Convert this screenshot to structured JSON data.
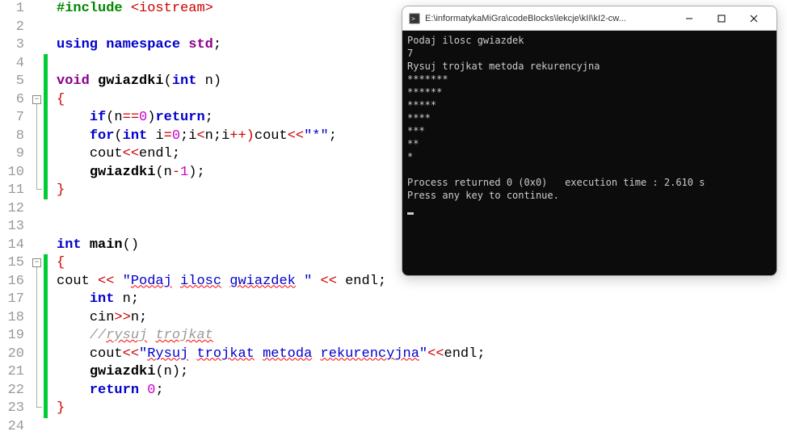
{
  "editor": {
    "lines": [
      {
        "n": "1",
        "tokens": [
          {
            "t": "#include ",
            "c": "kw-pre"
          },
          {
            "t": "<iostream>",
            "c": "angle"
          }
        ]
      },
      {
        "n": "2",
        "tokens": []
      },
      {
        "n": "3",
        "tokens": [
          {
            "t": "using ",
            "c": "kw"
          },
          {
            "t": "namespace ",
            "c": "kw"
          },
          {
            "t": "std",
            "c": "type"
          },
          {
            "t": ";",
            "c": "id"
          }
        ]
      },
      {
        "n": "4",
        "tokens": []
      },
      {
        "n": "5",
        "tokens": [
          {
            "t": "void ",
            "c": "type"
          },
          {
            "t": "gwiazdki",
            "c": "func"
          },
          {
            "t": "(",
            "c": "id"
          },
          {
            "t": "int ",
            "c": "kw"
          },
          {
            "t": "n",
            "c": "id"
          },
          {
            "t": ")",
            "c": "id"
          }
        ]
      },
      {
        "n": "6",
        "tokens": [
          {
            "t": "{",
            "c": "op"
          }
        ]
      },
      {
        "n": "7",
        "tokens": [
          {
            "t": "    ",
            "c": ""
          },
          {
            "t": "if",
            "c": "kw"
          },
          {
            "t": "(",
            "c": "id"
          },
          {
            "t": "n",
            "c": "id"
          },
          {
            "t": "==",
            "c": "op"
          },
          {
            "t": "0",
            "c": "num"
          },
          {
            "t": ")",
            "c": "id"
          },
          {
            "t": "return",
            "c": "kw"
          },
          {
            "t": ";",
            "c": "id"
          }
        ]
      },
      {
        "n": "8",
        "tokens": [
          {
            "t": "    ",
            "c": ""
          },
          {
            "t": "for",
            "c": "kw"
          },
          {
            "t": "(",
            "c": "id"
          },
          {
            "t": "int ",
            "c": "kw"
          },
          {
            "t": "i",
            "c": "id"
          },
          {
            "t": "=",
            "c": "op"
          },
          {
            "t": "0",
            "c": "num"
          },
          {
            "t": ";",
            "c": "id"
          },
          {
            "t": "i",
            "c": "id"
          },
          {
            "t": "<",
            "c": "op"
          },
          {
            "t": "n",
            "c": "id"
          },
          {
            "t": ";",
            "c": "id"
          },
          {
            "t": "i",
            "c": "id"
          },
          {
            "t": "++)",
            "c": "op"
          },
          {
            "t": "cout",
            "c": "id"
          },
          {
            "t": "<<",
            "c": "op"
          },
          {
            "t": "\"*\"",
            "c": "str"
          },
          {
            "t": ";",
            "c": "id"
          }
        ]
      },
      {
        "n": "9",
        "tokens": [
          {
            "t": "    ",
            "c": ""
          },
          {
            "t": "cout",
            "c": "id"
          },
          {
            "t": "<<",
            "c": "op"
          },
          {
            "t": "endl",
            "c": "id"
          },
          {
            "t": ";",
            "c": "id"
          }
        ]
      },
      {
        "n": "10",
        "tokens": [
          {
            "t": "    ",
            "c": ""
          },
          {
            "t": "gwiazdki",
            "c": "func"
          },
          {
            "t": "(",
            "c": "id"
          },
          {
            "t": "n",
            "c": "id"
          },
          {
            "t": "-",
            "c": "op"
          },
          {
            "t": "1",
            "c": "num"
          },
          {
            "t": ")",
            "c": "id"
          },
          {
            "t": ";",
            "c": "id"
          }
        ]
      },
      {
        "n": "11",
        "tokens": [
          {
            "t": "}",
            "c": "op"
          }
        ]
      },
      {
        "n": "12",
        "tokens": []
      },
      {
        "n": "13",
        "tokens": []
      },
      {
        "n": "14",
        "tokens": [
          {
            "t": "int ",
            "c": "kw"
          },
          {
            "t": "main",
            "c": "func"
          },
          {
            "t": "()",
            "c": "id"
          }
        ]
      },
      {
        "n": "15",
        "tokens": [
          {
            "t": "{",
            "c": "op"
          }
        ]
      },
      {
        "n": "16",
        "tokens": [
          {
            "t": "cout",
            "c": "id"
          },
          {
            "t": " << ",
            "c": "op"
          },
          {
            "t": "\"",
            "c": "str"
          },
          {
            "t": "Podaj",
            "c": "str squiggle"
          },
          {
            "t": " ",
            "c": "str"
          },
          {
            "t": "ilosc",
            "c": "str squiggle"
          },
          {
            "t": " ",
            "c": "str"
          },
          {
            "t": "gwiazdek",
            "c": "str squiggle"
          },
          {
            "t": " \"",
            "c": "str"
          },
          {
            "t": " << ",
            "c": "op"
          },
          {
            "t": "endl",
            "c": "id"
          },
          {
            "t": ";",
            "c": "id"
          }
        ]
      },
      {
        "n": "17",
        "tokens": [
          {
            "t": "    ",
            "c": ""
          },
          {
            "t": "int ",
            "c": "kw"
          },
          {
            "t": "n",
            "c": "id"
          },
          {
            "t": ";",
            "c": "id"
          }
        ]
      },
      {
        "n": "18",
        "tokens": [
          {
            "t": "    ",
            "c": ""
          },
          {
            "t": "cin",
            "c": "id"
          },
          {
            "t": ">>",
            "c": "op"
          },
          {
            "t": "n",
            "c": "id"
          },
          {
            "t": ";",
            "c": "id"
          }
        ]
      },
      {
        "n": "19",
        "tokens": [
          {
            "t": "    ",
            "c": ""
          },
          {
            "t": "//",
            "c": "comment"
          },
          {
            "t": "rysuj",
            "c": "comment squiggle"
          },
          {
            "t": " ",
            "c": "comment"
          },
          {
            "t": "trojkat",
            "c": "comment squiggle"
          }
        ]
      },
      {
        "n": "20",
        "tokens": [
          {
            "t": "    ",
            "c": ""
          },
          {
            "t": "cout",
            "c": "id"
          },
          {
            "t": "<<",
            "c": "op"
          },
          {
            "t": "\"",
            "c": "str"
          },
          {
            "t": "Rysuj",
            "c": "str squiggle"
          },
          {
            "t": " ",
            "c": "str"
          },
          {
            "t": "trojkat",
            "c": "str squiggle"
          },
          {
            "t": " ",
            "c": "str"
          },
          {
            "t": "metoda",
            "c": "str squiggle"
          },
          {
            "t": " ",
            "c": "str"
          },
          {
            "t": "rekurencyjna",
            "c": "str squiggle"
          },
          {
            "t": "\"",
            "c": "str"
          },
          {
            "t": "<<",
            "c": "op"
          },
          {
            "t": "endl",
            "c": "id"
          },
          {
            "t": ";",
            "c": "id"
          }
        ]
      },
      {
        "n": "21",
        "tokens": [
          {
            "t": "    ",
            "c": ""
          },
          {
            "t": "gwiazdki",
            "c": "func"
          },
          {
            "t": "(",
            "c": "id"
          },
          {
            "t": "n",
            "c": "id"
          },
          {
            "t": ")",
            "c": "id"
          },
          {
            "t": ";",
            "c": "id"
          }
        ]
      },
      {
        "n": "22",
        "tokens": [
          {
            "t": "    ",
            "c": ""
          },
          {
            "t": "return ",
            "c": "kw"
          },
          {
            "t": "0",
            "c": "num"
          },
          {
            "t": ";",
            "c": "id"
          }
        ]
      },
      {
        "n": "23",
        "tokens": [
          {
            "t": "}",
            "c": "op"
          }
        ]
      },
      {
        "n": "24",
        "tokens": []
      }
    ]
  },
  "console": {
    "title": "E:\\informatykaMiGra\\codeBlocks\\lekcje\\kII\\kI2-cw...",
    "output": "Podaj ilosc gwiazdek\n7\nRysuj trojkat metoda rekurencyjna\n*******\n******\n*****\n****\n***\n**\n*\n\nProcess returned 0 (0x0)   execution time : 2.610 s\nPress any key to continue.\n"
  }
}
